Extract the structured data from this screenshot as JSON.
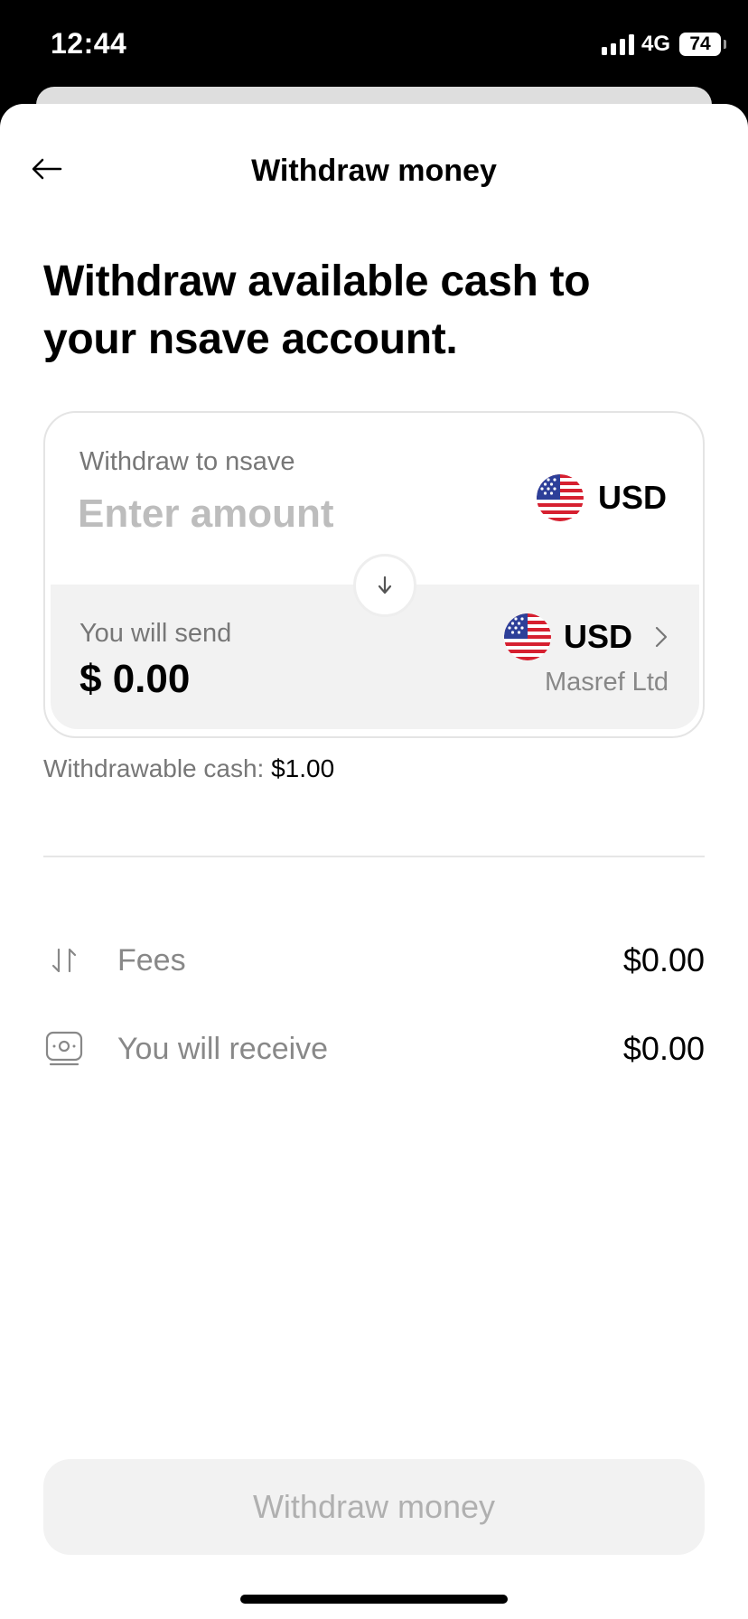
{
  "status_bar": {
    "time": "12:44",
    "network": "4G",
    "battery": "74"
  },
  "nav": {
    "title": "Withdraw money",
    "back_icon": "arrow-left-icon"
  },
  "headline": "Withdraw available cash to your nsave account.",
  "card": {
    "top": {
      "label": "Withdraw to nsave",
      "amount_placeholder": "Enter amount",
      "currency": "USD",
      "currency_icon": "us-flag-icon"
    },
    "swap_icon": "arrow-down-icon",
    "bottom": {
      "label": "You will send",
      "value": "$ 0.00",
      "currency": "USD",
      "currency_icon": "us-flag-icon",
      "provider": "Masref Ltd"
    }
  },
  "withdrawable": {
    "label": "Withdrawable cash: ",
    "value": "$1.00"
  },
  "summary": [
    {
      "label": "Fees",
      "value": "$0.00",
      "icon": "swap-vertical-icon"
    },
    {
      "label": "You will receive",
      "value": "$0.00",
      "icon": "cash-icon"
    }
  ],
  "cta": {
    "label": "Withdraw money"
  },
  "colors": {
    "accent_disabled_bg": "#f2f2f2",
    "muted_text": "#888888",
    "flag_red": "#d62030",
    "flag_blue": "#2d3f99"
  }
}
